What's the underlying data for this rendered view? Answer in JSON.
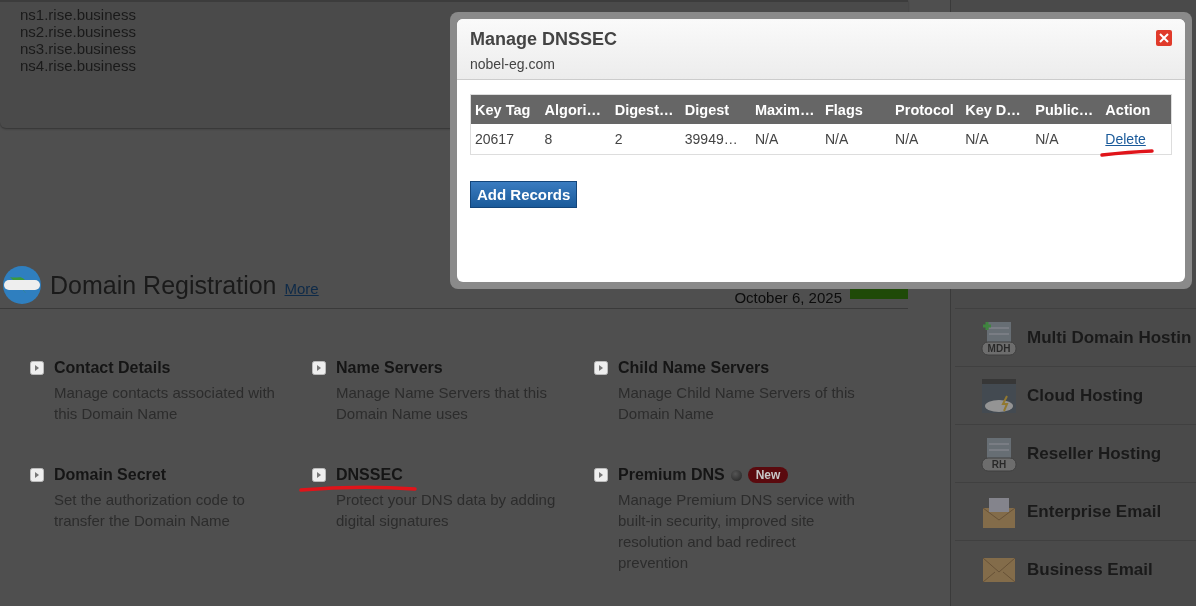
{
  "name_servers": [
    "ns1.rise.business",
    "ns2.rise.business",
    "ns3.rise.business",
    "ns4.rise.business"
  ],
  "domain_registration": {
    "title": "Domain Registration",
    "more_link": "More",
    "date": "October 6, 2025",
    "options": [
      {
        "title": "Contact Details",
        "description": "Manage contacts associated with this Domain Name",
        "dot": false,
        "underlined": false
      },
      {
        "title": "Name Servers",
        "description": "Manage Name Servers that this Domain Name uses",
        "dot": false,
        "underlined": false
      },
      {
        "title": "Child Name Servers",
        "description": "Manage Child Name Servers of this Domain Name",
        "dot": false,
        "underlined": false
      },
      {
        "title": "Domain Secret",
        "description": "Set the authorization code to transfer the Domain Name",
        "dot": false,
        "underlined": false
      },
      {
        "title": "DNSSEC",
        "description": "Protect your DNS data by adding digital signatures",
        "dot": false,
        "underlined": true
      },
      {
        "title": "Premium DNS",
        "description": "Manage Premium DNS service with built-in security, improved site resolution and bad redirect prevention",
        "dot": true,
        "underlined": false,
        "badge": "New"
      }
    ]
  },
  "sidebar": {
    "items": [
      {
        "kind": "multi",
        "label": "Multi Domain Hostin",
        "icon_label": "MDH"
      },
      {
        "kind": "cloud",
        "label": "Cloud Hosting"
      },
      {
        "kind": "reseller",
        "label": "Reseller Hosting",
        "icon_label": "RH"
      },
      {
        "kind": "enterprise",
        "label": "Enterprise Email"
      },
      {
        "kind": "business",
        "label": "Business Email"
      }
    ]
  },
  "modal": {
    "title": "Manage DNSSEC",
    "subtitle": "nobel-eg.com",
    "table": {
      "columns": [
        "Key Tag",
        "Algori…",
        "Digest…",
        "Digest",
        "Maxim…",
        "Flags",
        "Protocol",
        "Key D…",
        "Public…",
        "Action"
      ],
      "rows": [
        {
          "cells": [
            "20617",
            "8",
            "2",
            "39949…",
            "N/A",
            "N/A",
            "N/A",
            "N/A",
            "N/A"
          ],
          "action": "Delete",
          "action_underlined": true
        }
      ]
    },
    "add_button": "Add Records"
  }
}
